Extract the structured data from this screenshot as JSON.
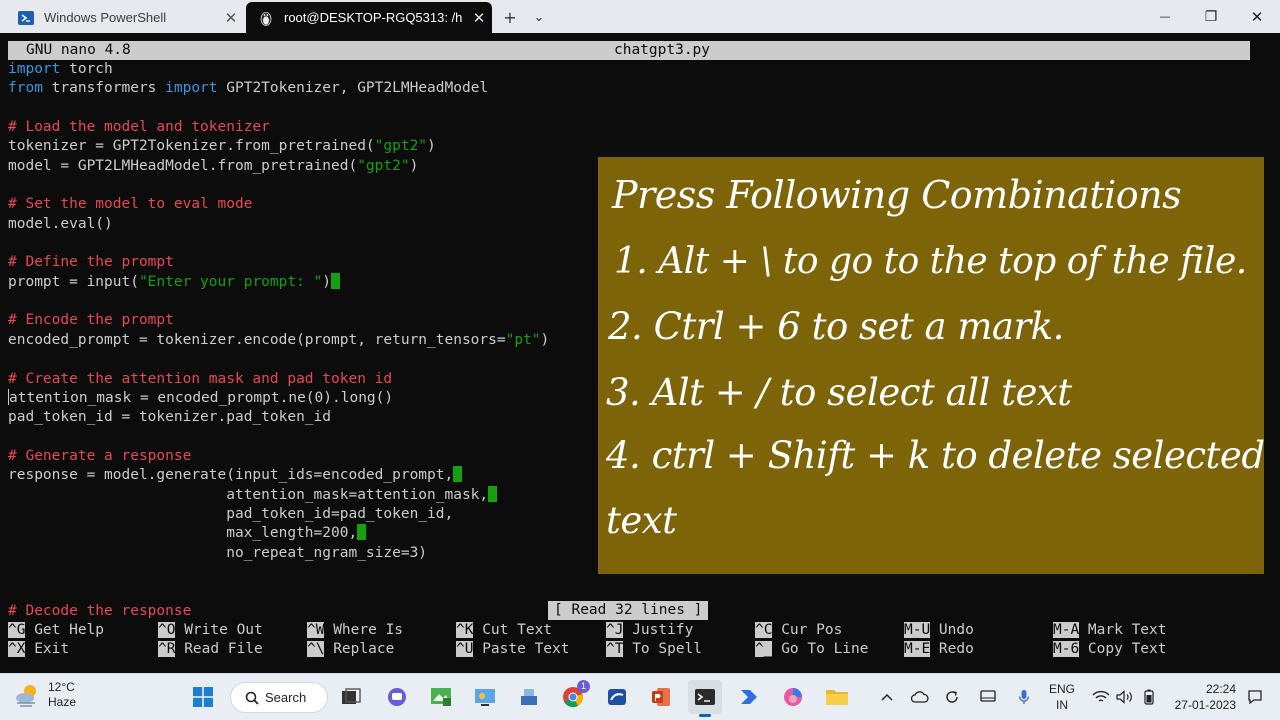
{
  "tabs": [
    {
      "label": "Windows PowerShell",
      "close": "✕"
    },
    {
      "label": "root@DESKTOP-RGQ5313: /h",
      "close": "✕"
    }
  ],
  "titlebar": {
    "new_tab": "+",
    "dropdown": "⌄",
    "minimize": "—",
    "maximize": "❐",
    "close": "✕"
  },
  "nano": {
    "version": "GNU nano 4.8",
    "filename": "chatgpt3.py",
    "status": "[ Read 32 lines ]"
  },
  "code_lines": [
    "import torch",
    "from transformers import GPT2Tokenizer, GPT2LMHeadModel",
    "",
    "# Load the model and tokenizer",
    "tokenizer = GPT2Tokenizer.from_pretrained(\"gpt2\")",
    "model = GPT2LMHeadModel.from_pretrained(\"gpt2\")",
    "",
    "# Set the model to eval mode",
    "model.eval()",
    "",
    "# Define the prompt",
    "prompt = input(\"Enter your prompt: \")",
    "",
    "# Encode the prompt",
    "encoded_prompt = tokenizer.encode(prompt, return_tensors=\"pt\")",
    "",
    "# Create the attention mask and pad token id",
    "attention_mask = encoded_prompt.ne(0).long()",
    "pad_token_id = tokenizer.pad_token_id",
    "",
    "# Generate a response",
    "response = model.generate(input_ids=encoded_prompt,",
    "                         attention_mask=attention_mask,",
    "                         pad_token_id=pad_token_id,",
    "                         max_length=200,",
    "                         no_repeat_ngram_size=3)",
    "",
    "",
    "# Decode the response"
  ],
  "shortcuts": [
    {
      "key": "^G",
      "label": "Get Help"
    },
    {
      "key": "^X",
      "label": "Exit"
    },
    {
      "key": "^O",
      "label": "Write Out"
    },
    {
      "key": "^R",
      "label": "Read File"
    },
    {
      "key": "^W",
      "label": "Where Is"
    },
    {
      "key": "^\\",
      "label": "Replace"
    },
    {
      "key": "^K",
      "label": "Cut Text"
    },
    {
      "key": "^U",
      "label": "Paste Text"
    },
    {
      "key": "^J",
      "label": "Justify"
    },
    {
      "key": "^T",
      "label": "To Spell"
    },
    {
      "key": "^C",
      "label": "Cur Pos"
    },
    {
      "key": "^_",
      "label": "Go To Line"
    },
    {
      "key": "M-U",
      "label": "Undo"
    },
    {
      "key": "M-E",
      "label": "Redo"
    },
    {
      "key": "M-A",
      "label": "Mark Text"
    },
    {
      "key": "M-6",
      "label": "Copy Text"
    }
  ],
  "overlay": {
    "title": "Press Following Combinations",
    "items": [
      "1. Alt + \\ to go to the top of the file.",
      "2. Ctrl + 6 to set a mark.",
      "3. Alt + /  to select all text",
      "4. ctrl + Shift + k to delete selected",
      "text"
    ],
    "background": "#7d6409"
  },
  "taskbar": {
    "weather_temp": "12°C",
    "weather_desc": "Haze",
    "search_label": "Search",
    "notification_badge": "1",
    "lang_top": "ENG",
    "lang_bottom": "IN",
    "time": "22:24",
    "date": "27-01-2023"
  },
  "colors": {
    "keyword": "#3a96dd",
    "comment": "#e74856",
    "string": "#13a10e",
    "text": "#cccccc"
  }
}
